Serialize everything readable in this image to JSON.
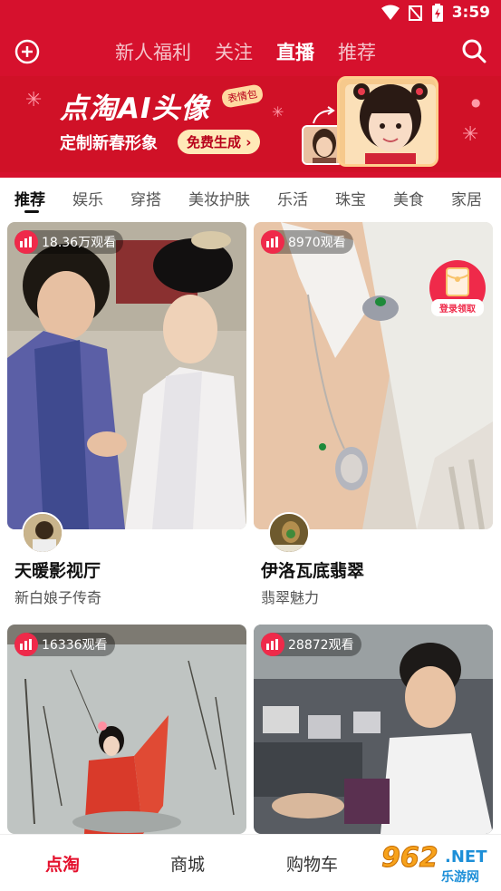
{
  "status_bar": {
    "time": "3:59"
  },
  "top_nav": {
    "tabs": [
      {
        "label": "新人福利",
        "active": false
      },
      {
        "label": "关注",
        "active": false
      },
      {
        "label": "直播",
        "active": true
      },
      {
        "label": "推荐",
        "active": false
      }
    ]
  },
  "banner": {
    "title": "点淘AI头像",
    "tag": "表情包",
    "subtitle": "定制新春形象",
    "cta": "免费生成 ›"
  },
  "categories": [
    {
      "label": "推荐",
      "active": true
    },
    {
      "label": "娱乐",
      "active": false
    },
    {
      "label": "穿搭",
      "active": false
    },
    {
      "label": "美妆护肤",
      "active": false
    },
    {
      "label": "乐活",
      "active": false
    },
    {
      "label": "珠宝",
      "active": false
    },
    {
      "label": "美食",
      "active": false
    },
    {
      "label": "家居",
      "active": false
    }
  ],
  "cards": [
    {
      "viewers": "18.36万观看",
      "title": "天暖影视厅",
      "subtitle": "新白娘子传奇"
    },
    {
      "viewers": "8970观看",
      "title": "伊洛瓦底翡翠",
      "subtitle": "翡翠魅力",
      "coupon": "登录领取"
    },
    {
      "viewers": "16336观看",
      "title": "",
      "subtitle": ""
    },
    {
      "viewers": "28872观看",
      "title": "",
      "subtitle": ""
    }
  ],
  "bottom_nav": {
    "items": [
      {
        "label": "点淘",
        "active": true
      },
      {
        "label": "商城",
        "active": false
      },
      {
        "label": "购物车",
        "active": false
      }
    ]
  },
  "watermark": {
    "number": "962",
    "net": ".NET",
    "label": "乐游网"
  },
  "colors": {
    "brand_red": "#d6112d",
    "live_red": "#ef2a4a"
  }
}
